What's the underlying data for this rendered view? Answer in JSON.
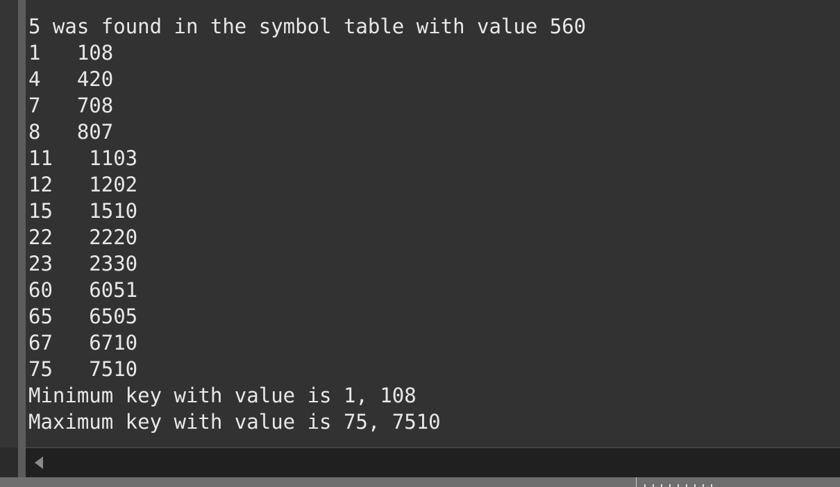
{
  "console": {
    "lines": [
      "5 was found in the symbol table with value 560",
      "1   108",
      "4   420",
      "7   708",
      "8   807",
      "11   1103",
      "12   1202",
      "15   1510",
      "22   2220",
      "23   2330",
      "60   6051",
      "65   6505",
      "67   6710",
      "75   7510",
      "Minimum key with value is 1, 108",
      "Maximum key with value is 75, 7510"
    ]
  },
  "scrollbar": {
    "left_arrow_icon": "scroll-left-arrow-icon"
  }
}
